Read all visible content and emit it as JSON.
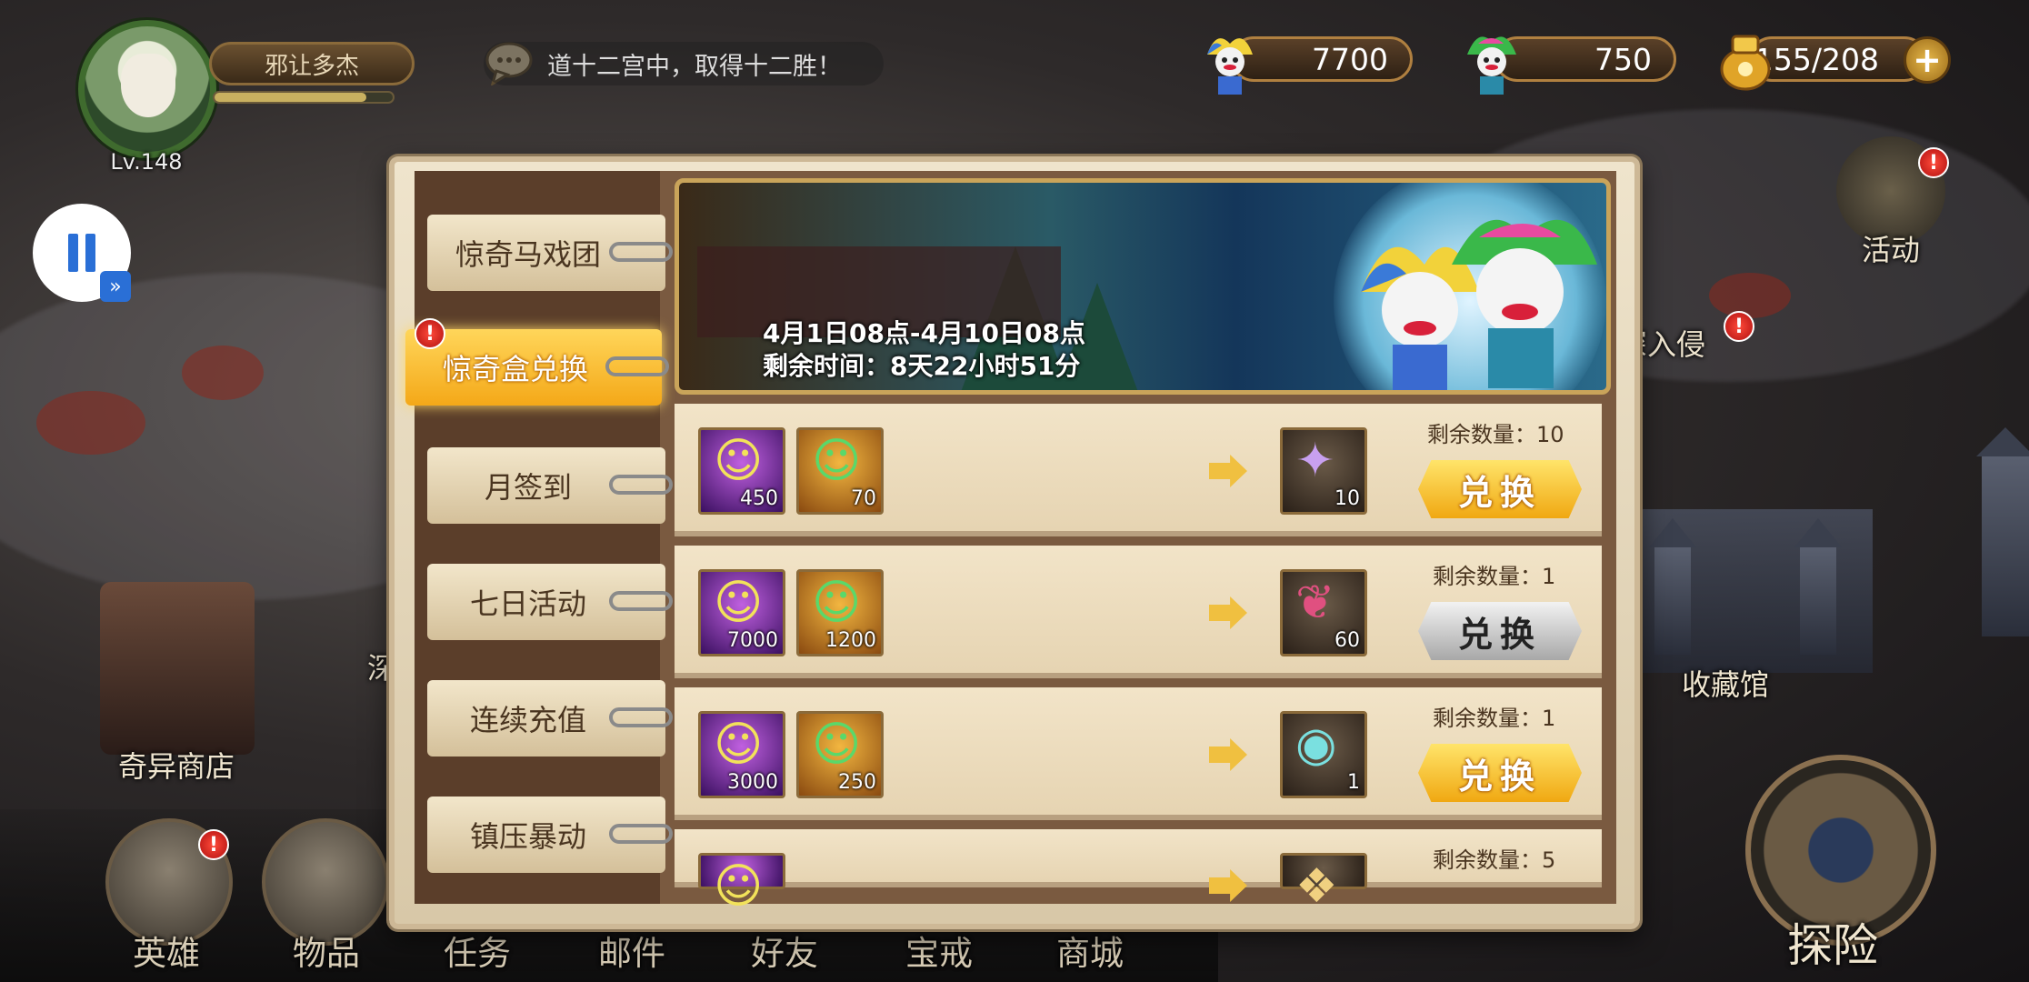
{
  "player": {
    "name": "邪让多杰",
    "level": "Lv.148",
    "exp_fraction": 0.85
  },
  "chat": {
    "message": "道十二宫中，取得十二胜！"
  },
  "resources": [
    {
      "icon": "purple-jester-icon",
      "value": "7700"
    },
    {
      "icon": "green-jester-icon",
      "value": "750"
    },
    {
      "icon": "stamina-bag-icon",
      "value": "155/208"
    }
  ],
  "side": {
    "activity": "活动",
    "invasion": "深入侵",
    "collection": "收藏馆",
    "strange_shop": "奇异商店",
    "deep": "深"
  },
  "nav": [
    "英雄",
    "物品",
    "任务",
    "邮件",
    "好友",
    "宝戒",
    "商城"
  ],
  "explore": "探险",
  "tabs": [
    "惊奇马戏团",
    "惊奇盒兑换",
    "月签到",
    "七日活动",
    "连续充值",
    "镇压暴动"
  ],
  "active_tab": 1,
  "banner": {
    "period": "4月1日08点-4月10日08点",
    "remaining": "剩余时间：8天22小时51分"
  },
  "rows": [
    {
      "cost": [
        "450",
        "70"
      ],
      "reward": "10",
      "reward_icon": "purple-card-icon",
      "remain": "剩余数量：10",
      "button": "兑换",
      "enabled": true
    },
    {
      "cost": [
        "7000",
        "1200"
      ],
      "reward": "60",
      "reward_icon": "dragon-pet-icon",
      "remain": "剩余数量：1",
      "button": "兑换",
      "enabled": false
    },
    {
      "cost": [
        "3000",
        "250"
      ],
      "reward": "1",
      "reward_icon": "spirit-orb-icon",
      "remain": "剩余数量：1",
      "button": "兑换",
      "enabled": true
    },
    {
      "cost": [
        ""
      ],
      "reward": "",
      "reward_icon": "scroll-icon",
      "remain": "剩余数量：5",
      "button": "",
      "enabled": true
    }
  ],
  "colors": {
    "gold": "#f4a818",
    "parchment": "#efe4cc",
    "panel_brown": "#5b3e2a"
  }
}
